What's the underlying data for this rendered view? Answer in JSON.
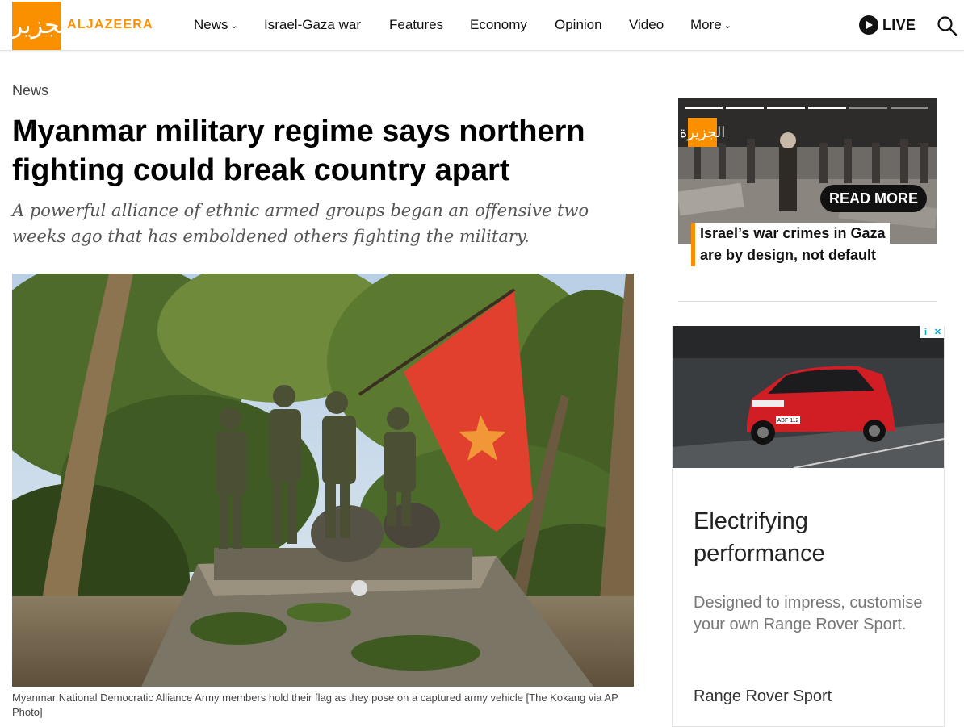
{
  "brand": {
    "logo_glyph": "الجزيرة",
    "name": "ALJAZEERA",
    "color": "#fa9000"
  },
  "nav": {
    "items": [
      {
        "label": "News",
        "has_dropdown": true
      },
      {
        "label": "Israel-Gaza war",
        "has_dropdown": false
      },
      {
        "label": "Features",
        "has_dropdown": false
      },
      {
        "label": "Economy",
        "has_dropdown": false
      },
      {
        "label": "Opinion",
        "has_dropdown": false
      },
      {
        "label": "Video",
        "has_dropdown": false
      },
      {
        "label": "More",
        "has_dropdown": true
      }
    ],
    "live_label": "LIVE",
    "icons": {
      "live": "play-circle-icon",
      "search": "search-icon",
      "dropdown": "chevron-down-icon"
    }
  },
  "article": {
    "section": "News",
    "headline": "Myanmar military regime says northern fighting could break country apart",
    "standfirst": "A powerful alliance of ethnic armed groups began an offensive two weeks ago that has emboldened others fighting the military.",
    "caption": "Myanmar National Democratic Alliance Army members hold their flag as they pose on a captured army vehicle [The Kokang via AP Photo]"
  },
  "sidebar": {
    "promo": {
      "read_more": "READ MORE",
      "title_line1": "Israel’s war crimes in Gaza",
      "title_line2": "are by design, not default",
      "slides_total": 6,
      "slide_active": 4
    }
  },
  "ad": {
    "badge_info": "i",
    "badge_close": "✕",
    "headline": "Electrifying performance",
    "body": "Designed to impress, customise your own Range Rover Sport.",
    "brand": "Range Rover Sport",
    "plate": "ABF 112"
  }
}
